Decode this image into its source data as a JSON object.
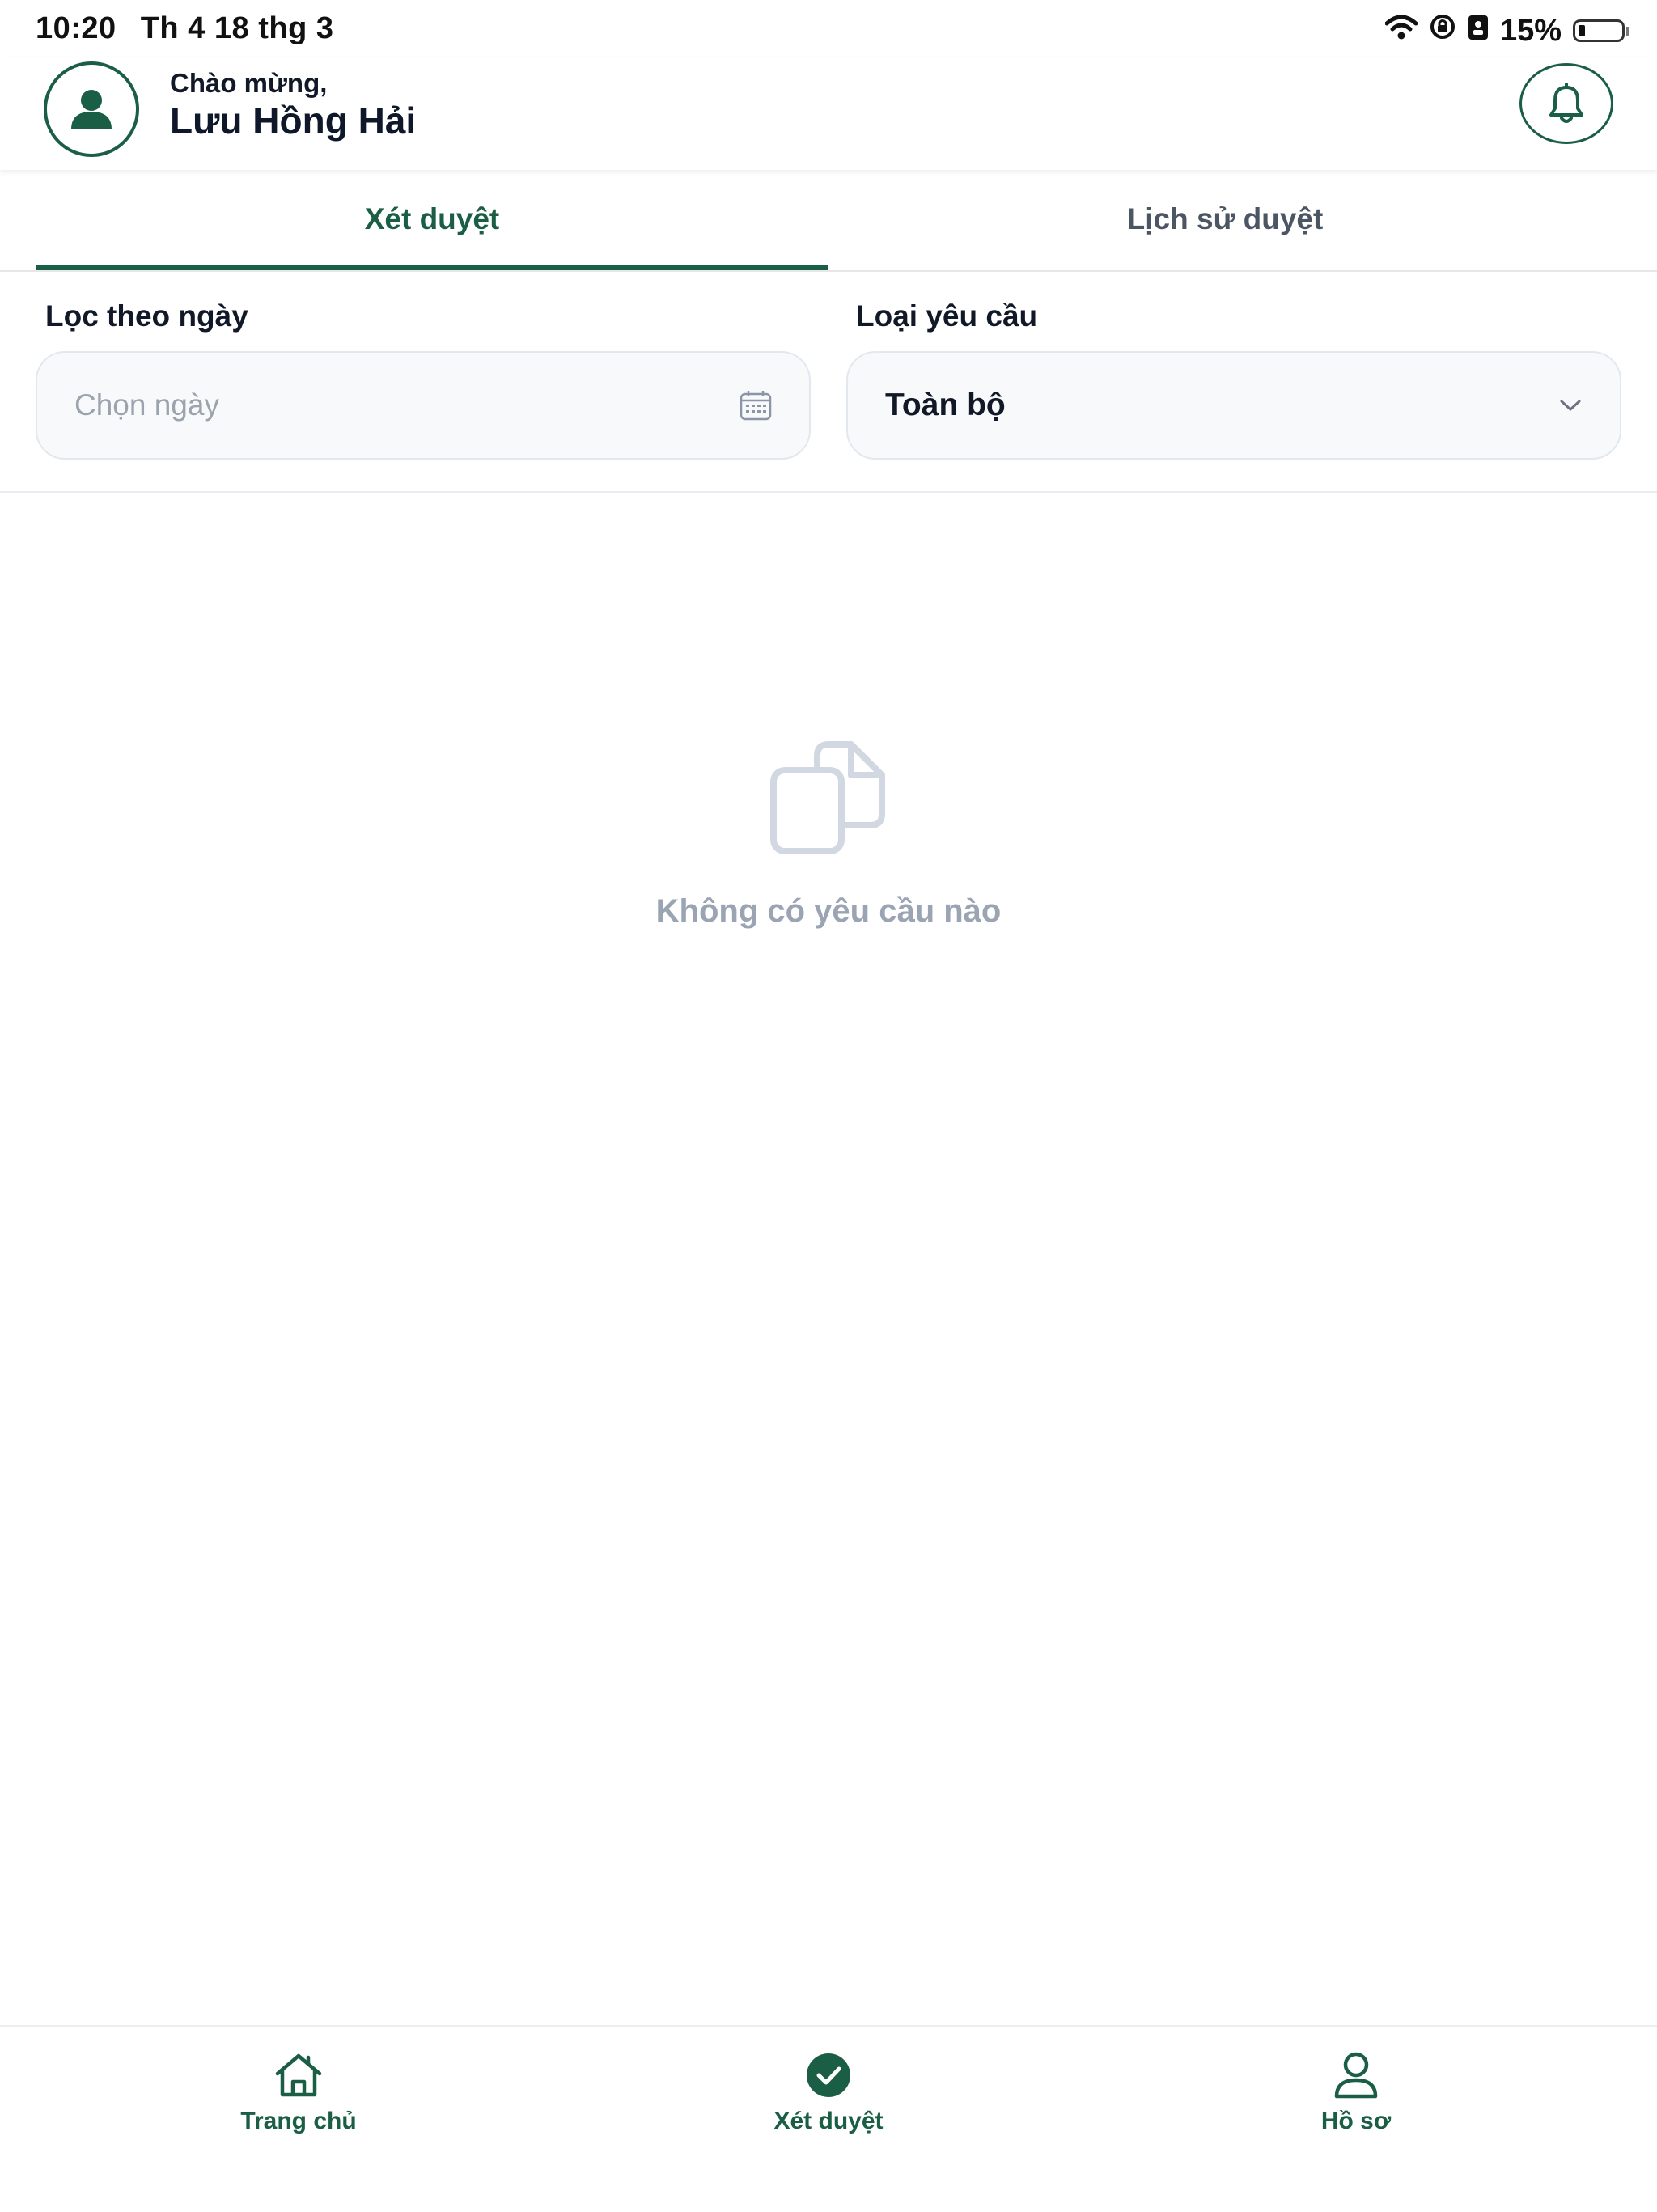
{
  "status_bar": {
    "time": "10:20",
    "date": "Th 4 18 thg 3",
    "battery": "15%",
    "battery_level": 0.15,
    "icons": [
      "wifi-icon",
      "rotation-lock-icon",
      "screen-mirroring-icon",
      "battery-icon"
    ]
  },
  "header": {
    "greeting": "Chào mừng,",
    "user_name": "Lưu Hồng Hải",
    "avatar_icon": "user-icon",
    "notification_icon": "bell-icon"
  },
  "tabs": [
    {
      "label": "Xét duyệt",
      "active": true
    },
    {
      "label": "Lịch sử duyệt",
      "active": false
    }
  ],
  "filters": {
    "date": {
      "label": "Lọc theo ngày",
      "placeholder": "Chọn ngày",
      "icon": "calendar-icon"
    },
    "request_type": {
      "label": "Loại yêu cầu",
      "value": "Toàn bộ",
      "icon": "chevron-down-icon"
    }
  },
  "empty_state": {
    "icon": "documents-icon",
    "message": "Không có yêu cầu nào"
  },
  "bottom_nav": [
    {
      "label": "Trang chủ",
      "icon": "home-icon",
      "active": false
    },
    {
      "label": "Xét duyệt",
      "icon": "check-circle-icon",
      "active": true
    },
    {
      "label": "Hồ sơ",
      "icon": "profile-icon",
      "active": false
    }
  ],
  "colors": {
    "primary": "#1a5e45",
    "text_dark": "#111827",
    "text_muted": "#9aa4b2",
    "field_bg": "#f7f9fb",
    "field_border": "#e3e8ef"
  }
}
